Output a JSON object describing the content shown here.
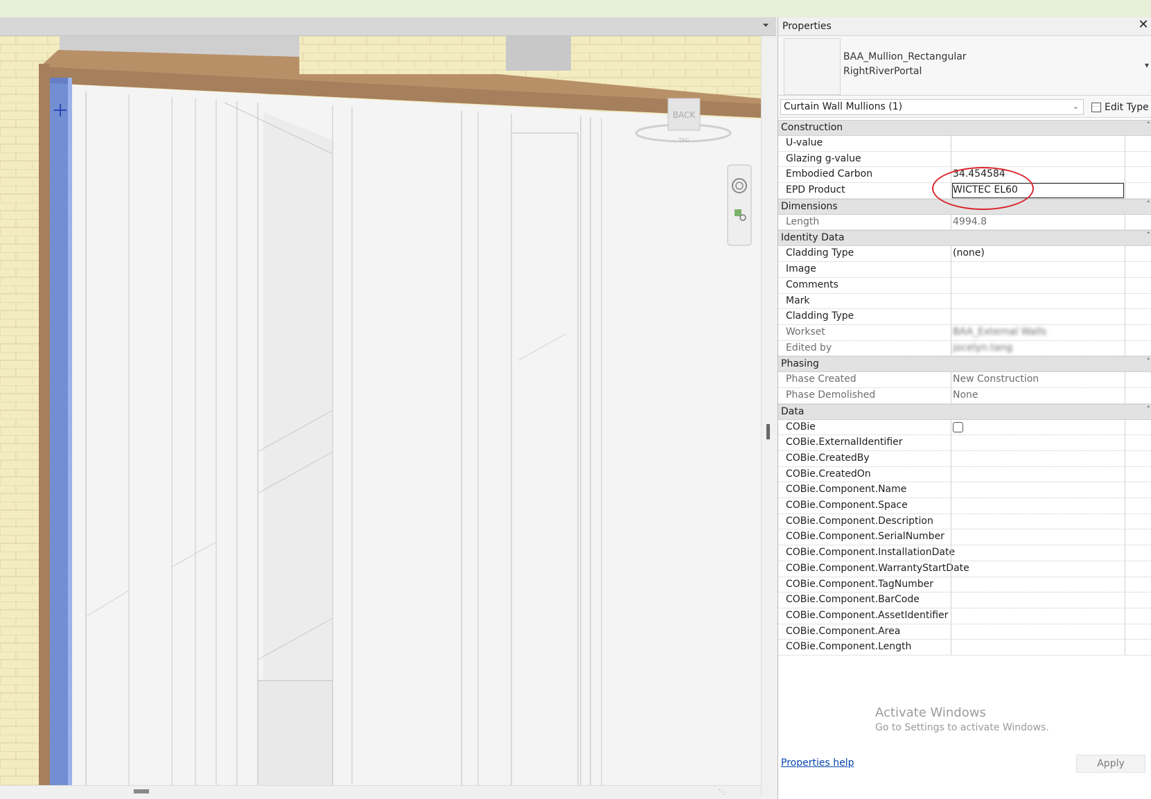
{
  "viewport": {
    "menu_glyph": "⏷",
    "viewcube_label": "BACK",
    "viewcube_ring_label": "TAG"
  },
  "properties": {
    "title": "Properties",
    "close_glyph": "✕",
    "family_name": "BAA_Mullion_Rectangular",
    "type_name": "RightRiverPortal",
    "instance_selector": "Curtain Wall Mullions (1)",
    "edit_type_label": "Edit Type",
    "sections": [
      {
        "label": "Construction",
        "rows": [
          {
            "name": "U-value",
            "value": ""
          },
          {
            "name": "Glazing g-value",
            "value": ""
          },
          {
            "name": "Embodied Carbon",
            "value": "34.454584"
          },
          {
            "name": "EPD Product",
            "value": "WICTEC EL60"
          }
        ]
      },
      {
        "label": "Dimensions",
        "rows": [
          {
            "name": "Length",
            "value": "4994.8"
          }
        ]
      },
      {
        "label": "Identity Data",
        "rows": [
          {
            "name": "Cladding Type",
            "value": "(none)"
          },
          {
            "name": "Image",
            "value": ""
          },
          {
            "name": "Comments",
            "value": ""
          },
          {
            "name": "Mark",
            "value": ""
          },
          {
            "name": "Cladding Type",
            "value": ""
          },
          {
            "name": "Workset",
            "value": "BAA_External Walls"
          },
          {
            "name": "Edited by",
            "value": "jocelyn.tang"
          }
        ]
      },
      {
        "label": "Phasing",
        "rows": [
          {
            "name": "Phase Created",
            "value": "New Construction"
          },
          {
            "name": "Phase Demolished",
            "value": "None"
          }
        ]
      },
      {
        "label": "Data",
        "rows": [
          {
            "name": "COBie",
            "value": ""
          },
          {
            "name": "COBie.ExternalIdentifier",
            "value": ""
          },
          {
            "name": "COBie.CreatedBy",
            "value": ""
          },
          {
            "name": "COBie.CreatedOn",
            "value": ""
          },
          {
            "name": "COBie.Component.Name",
            "value": ""
          },
          {
            "name": "COBie.Component.Space",
            "value": ""
          },
          {
            "name": "COBie.Component.Description",
            "value": ""
          },
          {
            "name": "COBie.Component.SerialNumber",
            "value": ""
          },
          {
            "name": "COBie.Component.InstallationDate",
            "value": ""
          },
          {
            "name": "COBie.Component.WarrantyStartDate",
            "value": ""
          },
          {
            "name": "COBie.Component.TagNumber",
            "value": ""
          },
          {
            "name": "COBie.Component.BarCode",
            "value": ""
          },
          {
            "name": "COBie.Component.AssetIdentifier",
            "value": ""
          },
          {
            "name": "COBie.Component.Area",
            "value": ""
          },
          {
            "name": "COBie.Component.Length",
            "value": ""
          }
        ]
      }
    ],
    "watermark_title": "Activate Windows",
    "watermark_sub": "Go to Settings to activate Windows.",
    "help_link": "Properties help",
    "apply_label": "Apply",
    "cobie_checked": false
  },
  "colors": {
    "annotation_circle": "#d9232a",
    "selection_blue": "#5b7fd6",
    "brick": "#f3ecc0",
    "timber": "#a67f5d",
    "link": "#0645ad"
  }
}
